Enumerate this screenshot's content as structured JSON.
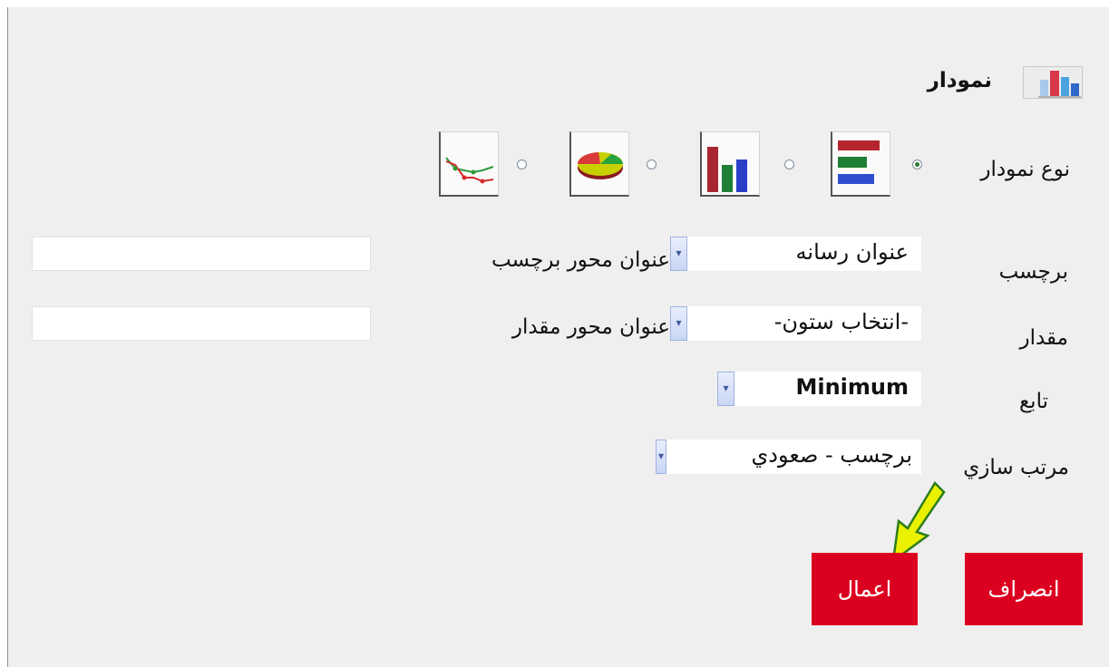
{
  "title": "نمودار",
  "chart_type": {
    "label": "نوع نمودار",
    "options": [
      "bar-horizontal-icon",
      "bar-vertical-icon",
      "pie-icon",
      "line-icon"
    ],
    "selected": "bar-horizontal-icon"
  },
  "fields": {
    "label_row": {
      "label": "برچسب",
      "value": "عنوان رسانه",
      "axis_label": "عنوان محور برچسب",
      "axis_value": ""
    },
    "value_row": {
      "label": "مقدار",
      "value": "-انتخاب ستون-",
      "axis_label": "عنوان محور مقدار",
      "axis_value": ""
    },
    "function_row": {
      "label": "تابع",
      "value": "Minimum"
    },
    "sort_row": {
      "label": "مرتب سازي",
      "value": "برچسب - صعودي"
    }
  },
  "buttons": {
    "apply": "اعمال",
    "cancel": "انصراف"
  },
  "colors": {
    "button": "#dc0020",
    "background": "#efefef",
    "arrow_fill": "#e9f000"
  }
}
